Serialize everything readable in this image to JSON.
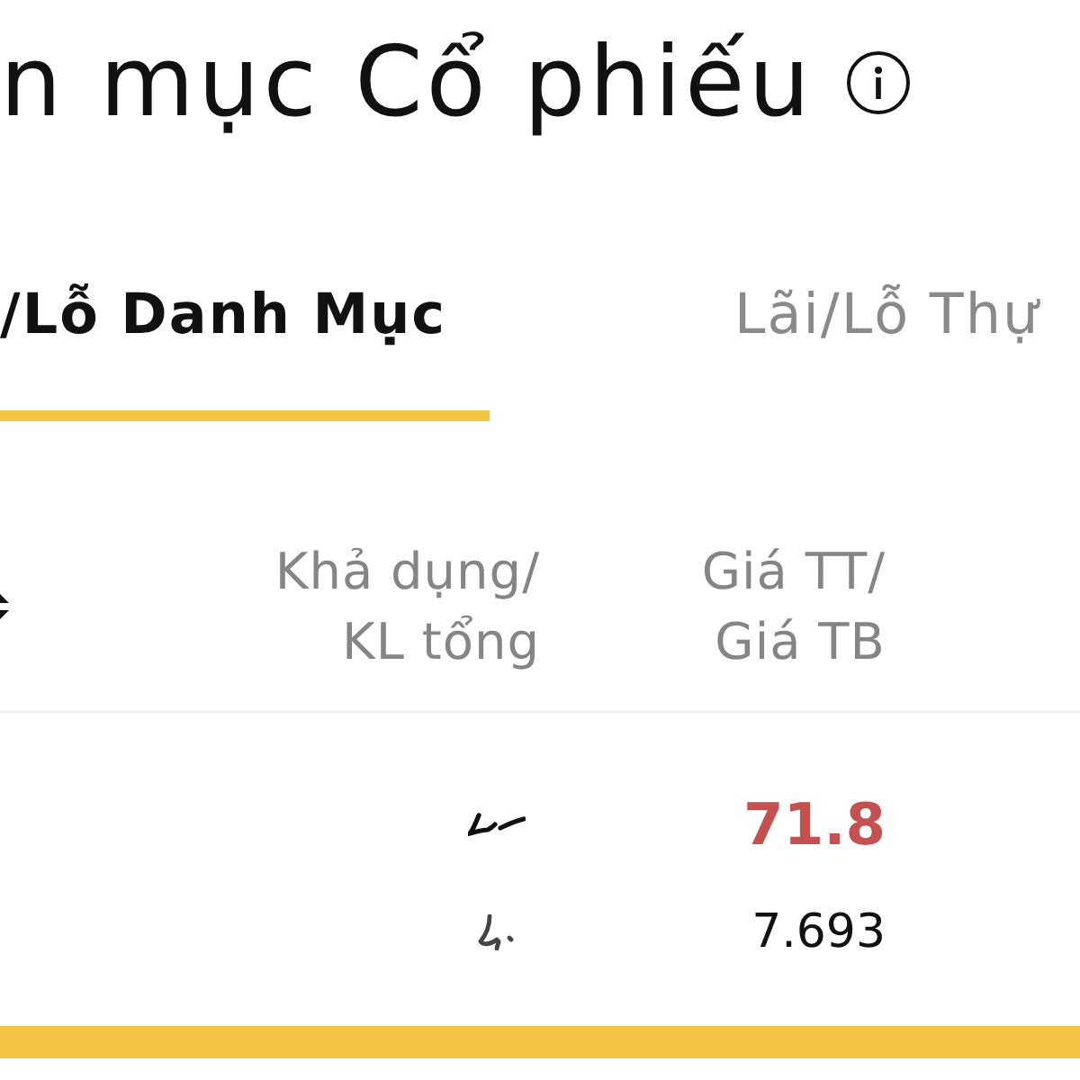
{
  "header": {
    "title": "n mục Cổ phiếu"
  },
  "tabs": [
    {
      "label": "/Lỗ Danh Mục",
      "selected": true
    },
    {
      "label": "Lãi/Lỗ Thự",
      "selected": false
    }
  ],
  "table": {
    "columns": [
      {
        "lines": [
          "Khả dụng/",
          "KL tổng"
        ]
      },
      {
        "lines": [
          "Giá TT/",
          "Giá TB"
        ]
      }
    ],
    "rows": [
      {
        "market_price": "71.8",
        "price_down": true,
        "average_price": "7.693"
      }
    ]
  }
}
